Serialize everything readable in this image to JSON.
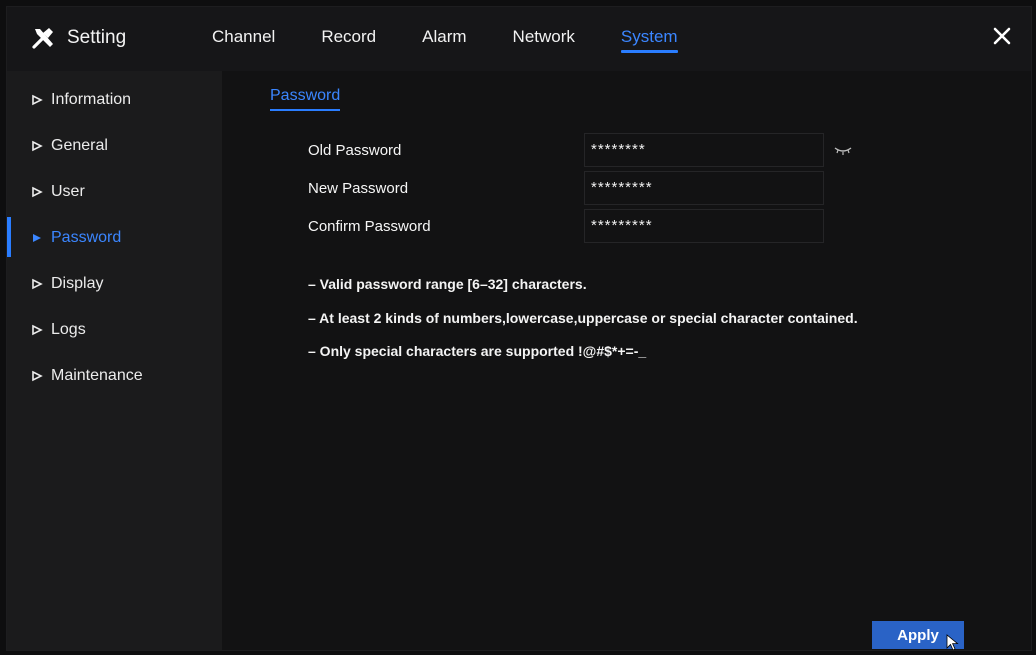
{
  "header": {
    "title": "Setting",
    "tabs": [
      {
        "label": "Channel"
      },
      {
        "label": "Record"
      },
      {
        "label": "Alarm"
      },
      {
        "label": "Network"
      },
      {
        "label": "System"
      }
    ],
    "active_tab": "System",
    "close_icon": "close-icon",
    "brand_icon": "tools-icon"
  },
  "sidebar": {
    "items": [
      {
        "label": "Information"
      },
      {
        "label": "General"
      },
      {
        "label": "User"
      },
      {
        "label": "Password"
      },
      {
        "label": "Display"
      },
      {
        "label": "Logs"
      },
      {
        "label": "Maintenance"
      }
    ],
    "active_item": "Password"
  },
  "main": {
    "section_title": "Password",
    "fields": [
      {
        "label": "Old Password",
        "value": "********"
      },
      {
        "label": "New Password",
        "value": "*********"
      },
      {
        "label": "Confirm Password",
        "value": "*********"
      }
    ],
    "notes": [
      "– Valid password range [6–32] characters.",
      "– At least 2 kinds of numbers,lowercase,uppercase or special character contained.",
      "– Only special characters are supported !@#$*+=-_"
    ],
    "apply_label": "Apply"
  },
  "colors": {
    "accent": "#2a7dff",
    "background": "#121213",
    "sidebar": "#1b1b1c",
    "button": "#2a63c6"
  }
}
